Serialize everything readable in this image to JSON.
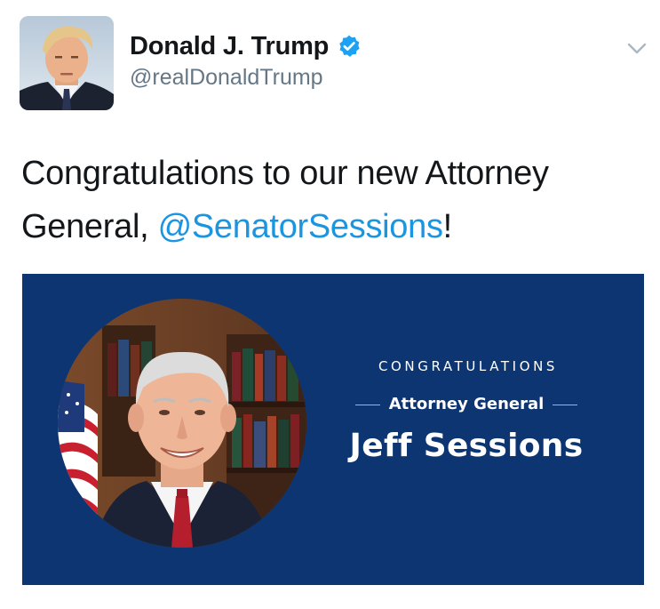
{
  "author": {
    "display_name": "Donald J. Trump",
    "handle": "@realDonaldTrump",
    "verified": true,
    "avatar_icon": "profile-photo"
  },
  "menu": {
    "icon": "chevron-down-icon"
  },
  "tweet": {
    "text_before": "Congratulations to our new Attorney General, ",
    "mention": "@SenatorSessions",
    "text_after": "!"
  },
  "media_card": {
    "heading": "CONGRATULATIONS",
    "role": "Attorney General",
    "name": "Jeff Sessions"
  },
  "colors": {
    "link": "#1b95e0",
    "verified_badge": "#1da1f2",
    "card_background": "#0d3571",
    "secondary_text": "#657786"
  }
}
